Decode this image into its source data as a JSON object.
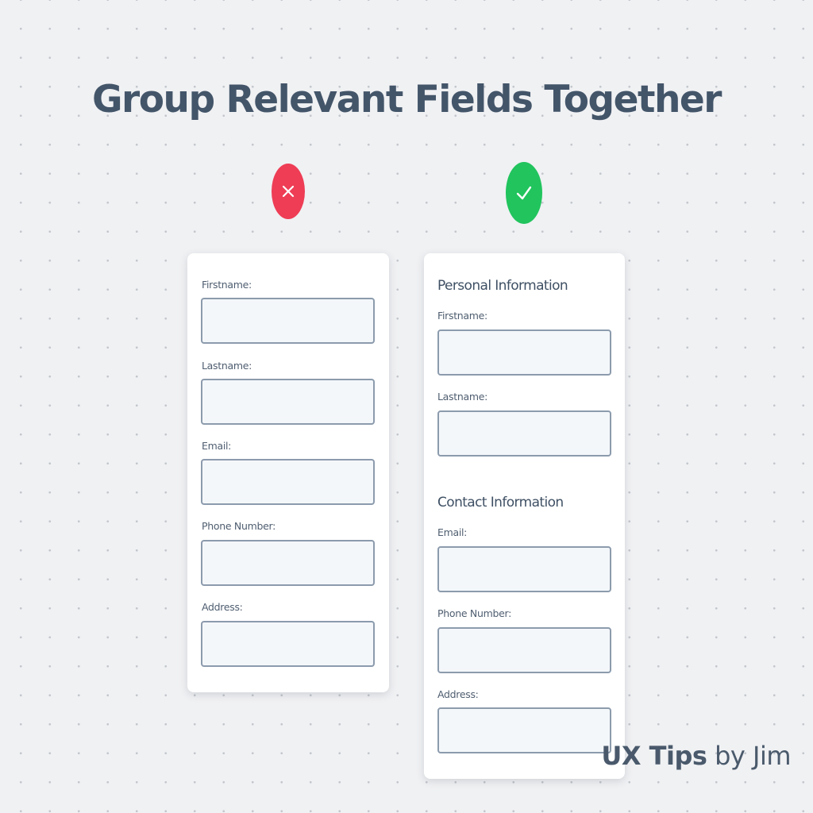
{
  "title": "Group Relevant Fields Together",
  "colors": {
    "background": "#f0f1f3",
    "bad_badge": "#ee3d55",
    "good_badge": "#21c45d",
    "input_fill": "#f4f7fa",
    "input_border": "#8c9bad",
    "text": "#435569"
  },
  "badges": {
    "bad_icon": "cross-icon",
    "good_icon": "check-icon"
  },
  "bad_form": {
    "fields": [
      {
        "label": "Firstname:",
        "value": ""
      },
      {
        "label": "Lastname:",
        "value": ""
      },
      {
        "label": "Email:",
        "value": ""
      },
      {
        "label": "Phone Number:",
        "value": ""
      },
      {
        "label": "Address:",
        "value": ""
      }
    ]
  },
  "good_form": {
    "sections": [
      {
        "heading": "Personal Information",
        "fields": [
          {
            "label": "Firstname:",
            "value": ""
          },
          {
            "label": "Lastname:",
            "value": ""
          }
        ]
      },
      {
        "heading": "Contact Information",
        "fields": [
          {
            "label": "Email:",
            "value": ""
          },
          {
            "label": "Phone Number:",
            "value": ""
          },
          {
            "label": "Address:",
            "value": ""
          }
        ]
      }
    ]
  },
  "credit": {
    "brand": "UX Tips",
    "author": "by Jim"
  }
}
